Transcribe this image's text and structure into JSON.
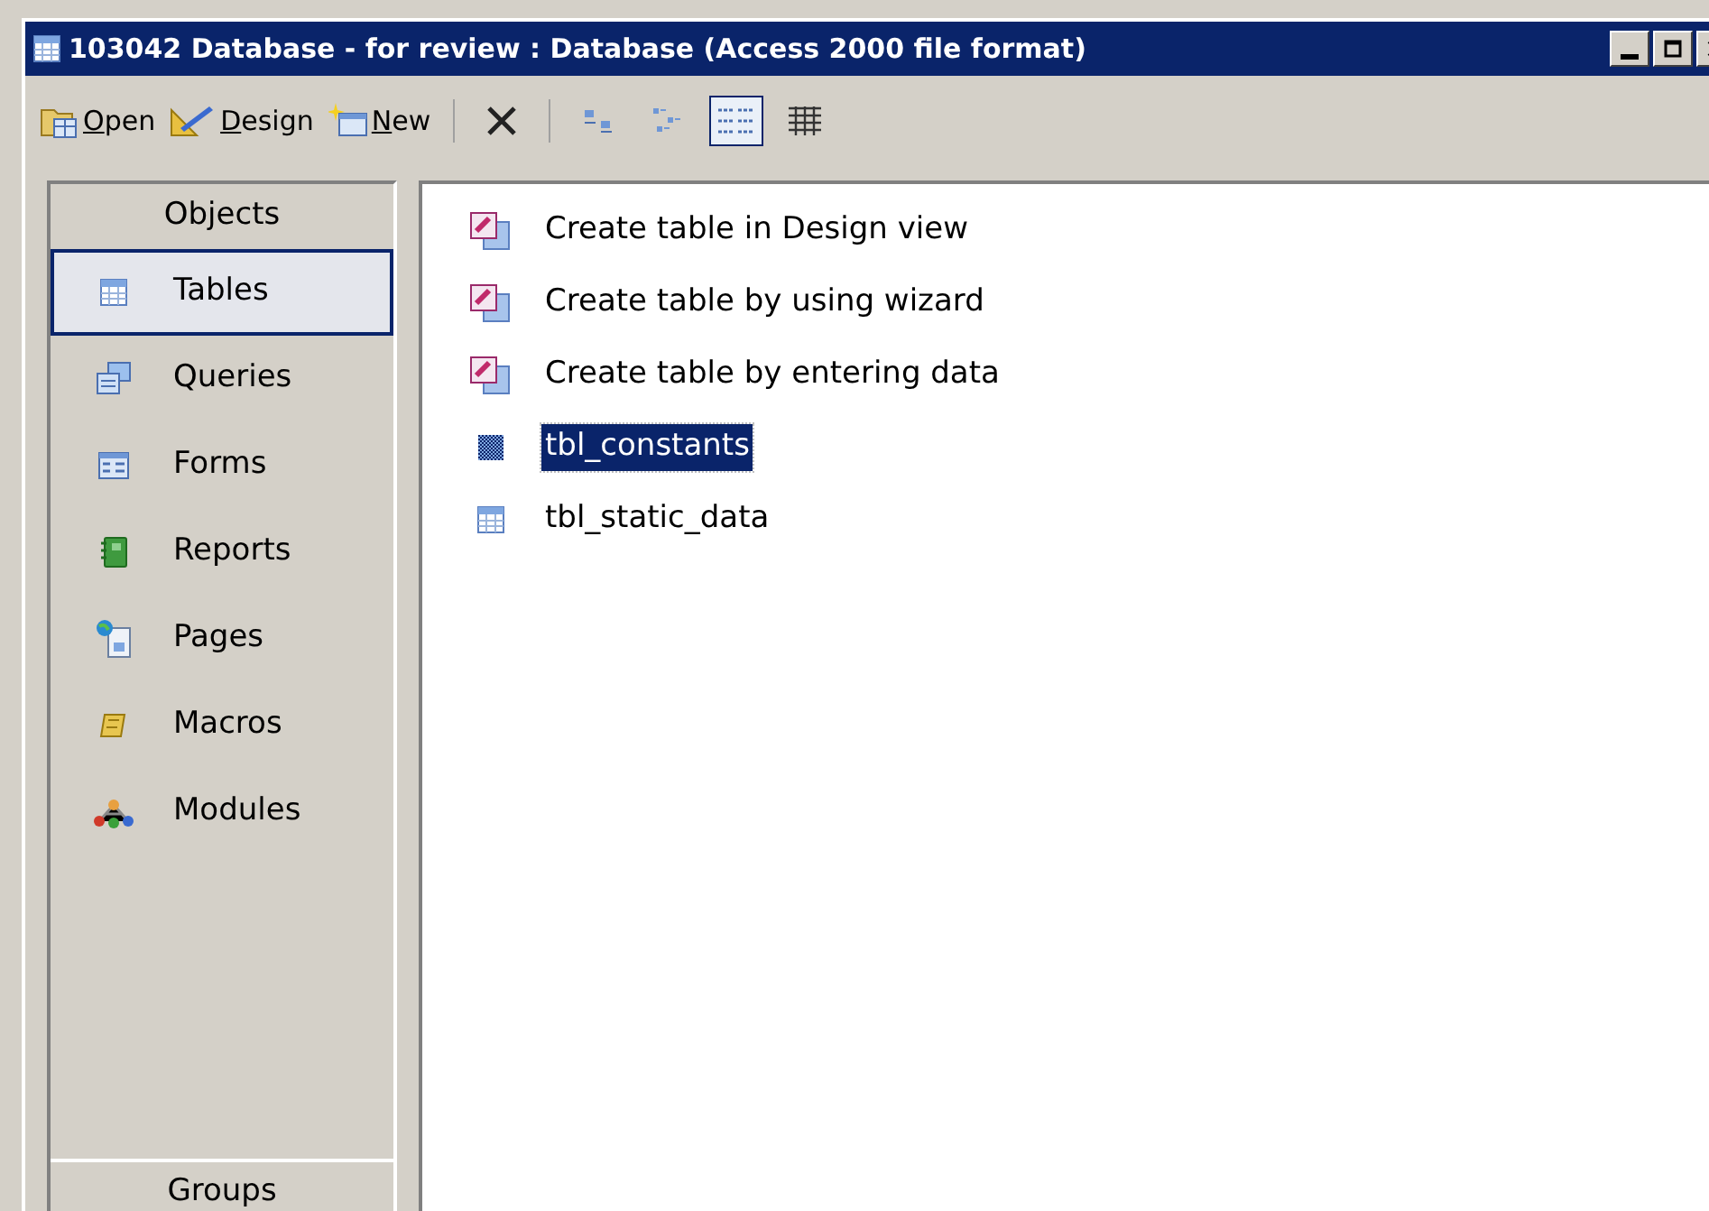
{
  "window": {
    "title": "103042 Database - for review : Database (Access 2000 file format)",
    "controls": [
      {
        "kind": "minimize"
      },
      {
        "kind": "maximize"
      },
      {
        "kind": "close"
      }
    ]
  },
  "toolbar": {
    "buttons": [
      {
        "kind": "open",
        "label": "Open"
      },
      {
        "kind": "design",
        "label": "Design"
      },
      {
        "kind": "new",
        "label": "New"
      }
    ],
    "views": [
      {
        "kind": "large",
        "selected": false
      },
      {
        "kind": "small",
        "selected": false
      },
      {
        "kind": "list",
        "selected": true
      },
      {
        "kind": "details",
        "selected": false
      }
    ]
  },
  "sidebar": {
    "header": "Objects",
    "items": [
      {
        "kind": "tables",
        "label": "Tables",
        "selected": true
      },
      {
        "kind": "queries",
        "label": "Queries",
        "selected": false
      },
      {
        "kind": "forms",
        "label": "Forms",
        "selected": false
      },
      {
        "kind": "reports",
        "label": "Reports",
        "selected": false
      },
      {
        "kind": "pages",
        "label": "Pages",
        "selected": false
      },
      {
        "kind": "macros",
        "label": "Macros",
        "selected": false
      },
      {
        "kind": "modules",
        "label": "Modules",
        "selected": false
      }
    ],
    "footer": "Groups"
  },
  "list": {
    "items": [
      {
        "kind": "shortcut",
        "label": "Create table in Design view",
        "selected": false
      },
      {
        "kind": "shortcut",
        "label": "Create table by using wizard",
        "selected": false
      },
      {
        "kind": "shortcut",
        "label": "Create table by entering data",
        "selected": false
      },
      {
        "kind": "table",
        "label": "tbl_constants",
        "selected": true
      },
      {
        "kind": "table",
        "label": "tbl_static_data",
        "selected": false
      }
    ]
  }
}
